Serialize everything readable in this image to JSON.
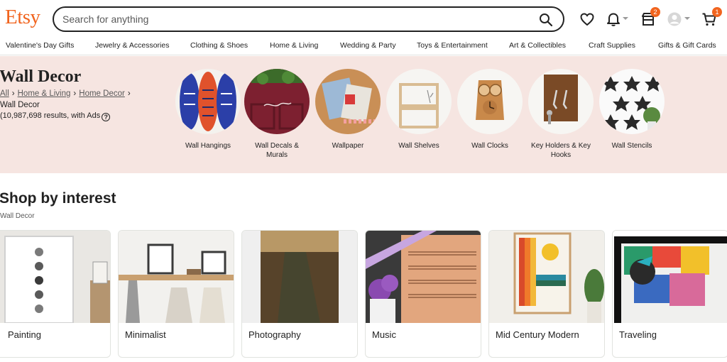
{
  "header": {
    "logo": "Etsy",
    "search_placeholder": "Search for anything",
    "notifications_badge": "2",
    "cart_badge": "1"
  },
  "nav": [
    "Valentine's Day Gifts",
    "Jewelry & Accessories",
    "Clothing & Shoes",
    "Home & Living",
    "Wedding & Party",
    "Toys & Entertainment",
    "Art & Collectibles",
    "Craft Supplies",
    "Gifts & Gift Cards"
  ],
  "banner": {
    "title": "Wall Decor",
    "breadcrumb": [
      "All",
      "Home & Living",
      "Home Decor"
    ],
    "current": "Wall Decor",
    "results": "(10,987,698 results, with Ads",
    "help_glyph": "?",
    "categories": [
      "Wall Hangings",
      "Wall Decals & Murals",
      "Wallpaper",
      "Wall Shelves",
      "Wall Clocks",
      "Key Holders & Key Hooks",
      "Wall Stencils"
    ]
  },
  "interest": {
    "title": "Shop by interest",
    "subtitle": "Wall Decor",
    "cards": [
      "Painting",
      "Minimalist",
      "Photography",
      "Music",
      "Mid Century Modern",
      "Traveling"
    ]
  },
  "colors": {
    "brand": "#f1641e",
    "banner_bg": "#f6e5e1"
  }
}
